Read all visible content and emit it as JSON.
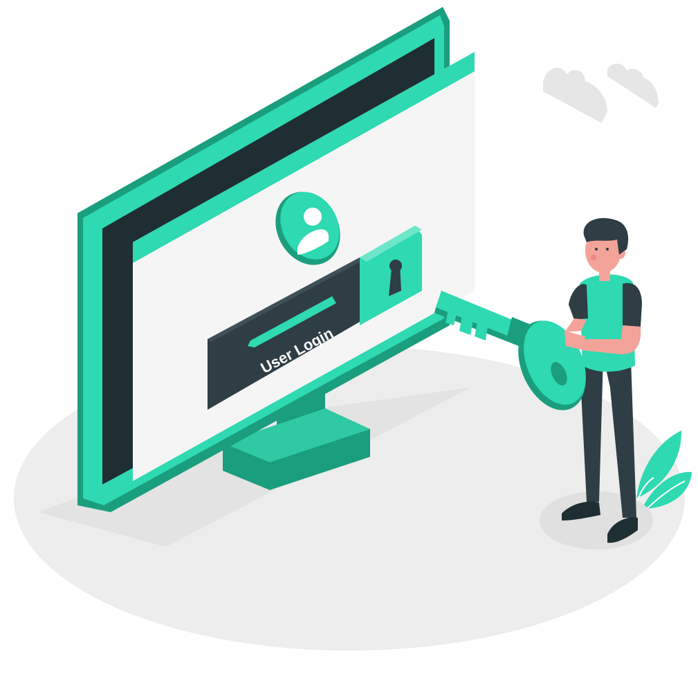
{
  "illustration": {
    "login_label": "User Login",
    "colors": {
      "accent": "#2fd9b2",
      "accent_dark": "#1a9e7e",
      "dark": "#2f3d44",
      "screen_dark": "#1f2e33",
      "window_bg": "#f5f5f5",
      "floor": "#ededed",
      "cloud": "#e6e6e6",
      "skin": "#f4a39a"
    },
    "icons": [
      "user-icon",
      "keyhole-icon",
      "key-icon",
      "cloud-icon",
      "plant-icon"
    ]
  }
}
